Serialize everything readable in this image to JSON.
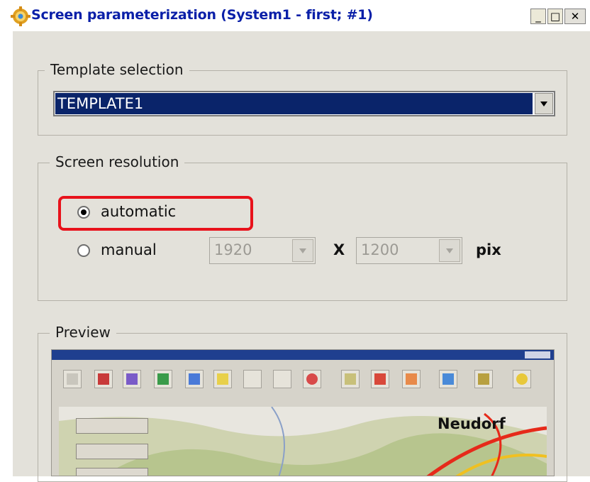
{
  "window": {
    "title": "Screen parameterization (System1 - first; #1)",
    "icon": "gear-icon",
    "caption_buttons": [
      "minimize",
      "maximize",
      "close"
    ]
  },
  "template_selection": {
    "group_label": "Template selection",
    "selected": "TEMPLATE1"
  },
  "screen_resolution": {
    "group_label": "Screen resolution",
    "automatic_label": "automatic",
    "manual_label": "manual",
    "selected_mode": "automatic",
    "width": "1920",
    "separator": "X",
    "height": "1200",
    "unit": "pix"
  },
  "preview": {
    "group_label": "Preview",
    "map_label": "Neudorf"
  },
  "colors": {
    "title_text": "#0a1fa8",
    "selection_bg": "#0a246a",
    "highlight": "#e8121b",
    "dialog_bg": "#e3e1da"
  }
}
